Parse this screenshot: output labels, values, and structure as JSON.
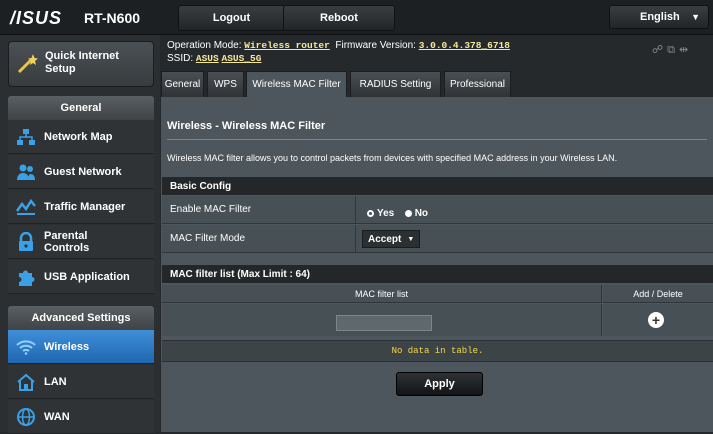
{
  "header": {
    "brand": "/ISUS",
    "model": "RT-N600",
    "logout_label": "Logout",
    "reboot_label": "Reboot",
    "language": "English"
  },
  "info": {
    "operation_mode_label": "Operation Mode:",
    "operation_mode_value": "Wireless router",
    "firmware_label": "Firmware Version:",
    "firmware_value": "3.0.0.4.378_6718",
    "ssid_label": "SSID:",
    "ssid_1": "ASUS",
    "ssid_2": "ASUS_5G"
  },
  "sidebar": {
    "quick_setup_line1": "Quick Internet",
    "quick_setup_line2": "Setup",
    "general_header": "General",
    "items": [
      {
        "label": "Network Map",
        "icon": "network-map-icon"
      },
      {
        "label": "Guest Network",
        "icon": "guest-network-icon"
      },
      {
        "label": "Traffic Manager",
        "icon": "traffic-manager-icon"
      },
      {
        "label_line1": "Parental",
        "label_line2": "Controls",
        "icon": "lock-icon"
      },
      {
        "label": "USB Application",
        "icon": "puzzle-icon"
      }
    ],
    "advanced_header": "Advanced Settings",
    "advanced_items": [
      {
        "label": "Wireless",
        "icon": "wifi-icon",
        "active": true
      },
      {
        "label": "LAN",
        "icon": "home-icon"
      },
      {
        "label": "WAN",
        "icon": "globe-icon"
      }
    ]
  },
  "tabs": [
    "General",
    "WPS",
    "Wireless MAC Filter",
    "RADIUS Setting",
    "Professional"
  ],
  "page": {
    "title": "Wireless - Wireless MAC Filter",
    "description": "Wireless MAC filter allows you to control packets from devices with specified MAC address in your Wireless LAN.",
    "basic_config_header": "Basic Config",
    "enable_label": "Enable MAC Filter",
    "yes_label": "Yes",
    "no_label": "No",
    "mode_label": "MAC Filter Mode",
    "mode_value": "Accept",
    "list_header": "MAC filter list (Max Limit : 64)",
    "col_mac": "MAC filter list",
    "col_action": "Add / Delete",
    "no_data": "No data in table.",
    "apply_label": "Apply"
  },
  "colors": {
    "accent_active": "#2a78c4",
    "panel": "#4d565c",
    "no_data_text": "#f4d84a"
  }
}
